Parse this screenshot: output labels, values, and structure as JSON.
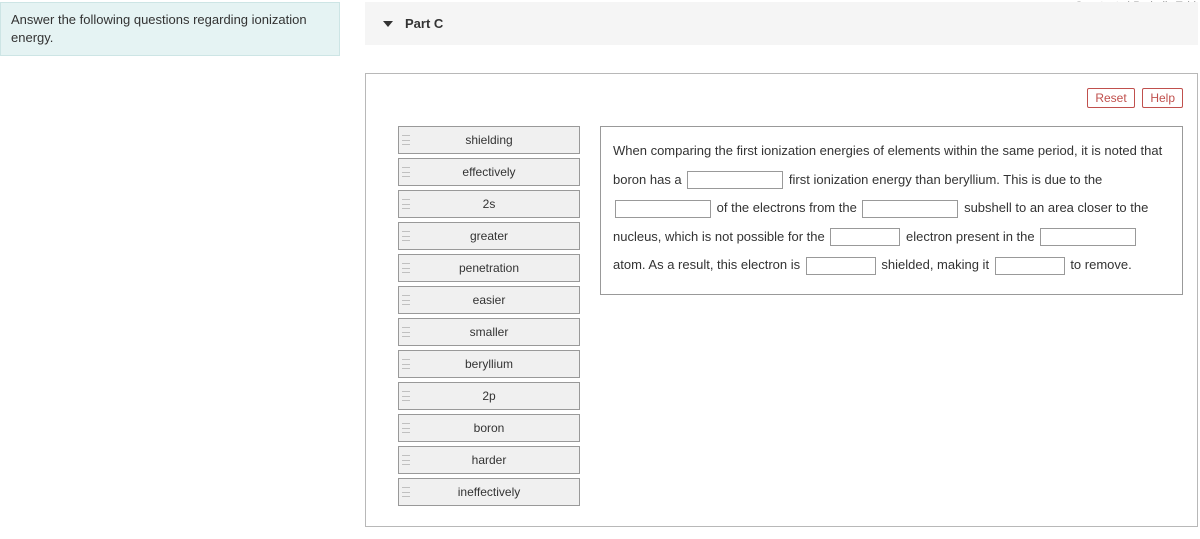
{
  "topLinks": "Constants | Periodic Tabl",
  "prompt": "Answer the following questions regarding ionization energy.",
  "partLabel": "Part C",
  "controls": {
    "reset": "Reset",
    "help": "Help"
  },
  "bank": [
    "shielding",
    "effectively",
    "2s",
    "greater",
    "penetration",
    "easier",
    "smaller",
    "beryllium",
    "2p",
    "boron",
    "harder",
    "ineffectively"
  ],
  "sentence": {
    "s0": "When comparing the first ionization energies of elements within the same period, it is noted that boron has a",
    "s1": "first ionization energy than beryllium. This is due to the",
    "s2": "of the electrons from the",
    "s3": "subshell to an area closer to the nucleus, which is not possible for the",
    "s4": "electron present in the",
    "s5": "atom. As a result, this electron is",
    "s6": "shielded, making it",
    "s7": "to remove."
  }
}
